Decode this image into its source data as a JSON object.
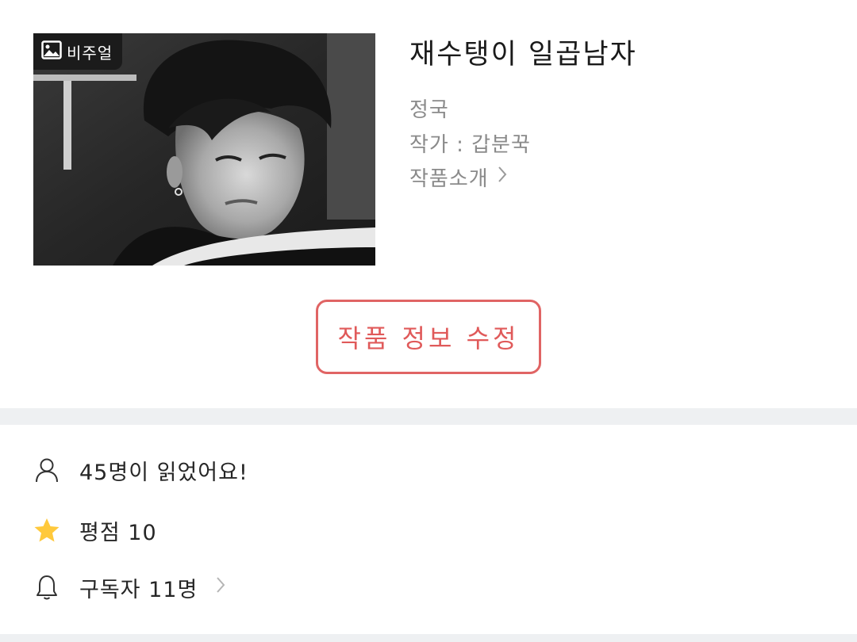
{
  "work": {
    "title": "재수탱이 일곱남자",
    "genre": "정국",
    "author": "작가 : 갑분꾹",
    "intro_link": "작품소개",
    "thumbnail": {
      "badge_label": "비주얼",
      "badge_icon": "image-icon",
      "chevron_icon": "chevron-right-icon"
    }
  },
  "actions": {
    "edit_label": "작품 정보 수정",
    "edit_color": "#e05a5a"
  },
  "stats": {
    "readers": {
      "icon": "person-icon",
      "text": "45명이 읽었어요!"
    },
    "rating": {
      "icon": "star-icon",
      "text": "평점 10",
      "icon_color": "#ffc93c"
    },
    "subscribers": {
      "icon": "bell-icon",
      "text": "구독자 11명"
    }
  }
}
